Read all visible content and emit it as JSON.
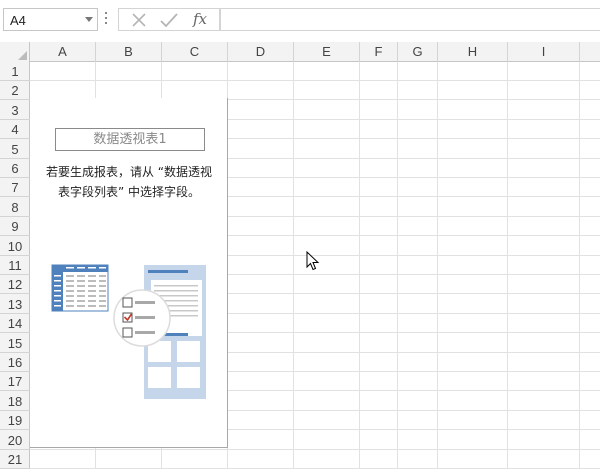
{
  "formula_bar": {
    "name_box": "A4",
    "cancel_icon": "cancel-x-icon",
    "enter_icon": "checkmark-icon",
    "function_label": "fx",
    "formula": ""
  },
  "columns": [
    "A",
    "B",
    "C",
    "D",
    "E",
    "F",
    "G",
    "H",
    "I"
  ],
  "rows": [
    "1",
    "2",
    "3",
    "4",
    "5",
    "6",
    "7",
    "8",
    "9",
    "10",
    "11",
    "12",
    "13",
    "14",
    "15",
    "16",
    "17",
    "18",
    "19",
    "20",
    "21"
  ],
  "pivot": {
    "name": "数据透视表1",
    "message_line1": "若要生成报表，请从 “数据透视",
    "message_line2": "表字段列表” 中选择字段。",
    "illustration_icon": "pivot-table-illustration"
  },
  "colors": {
    "header_bg": "#f3f3f3",
    "gridline": "#e1e1e1",
    "illustration_blue": "#4f81bd",
    "illustration_light": "#c5d5ea",
    "check_red": "#c0392b"
  }
}
